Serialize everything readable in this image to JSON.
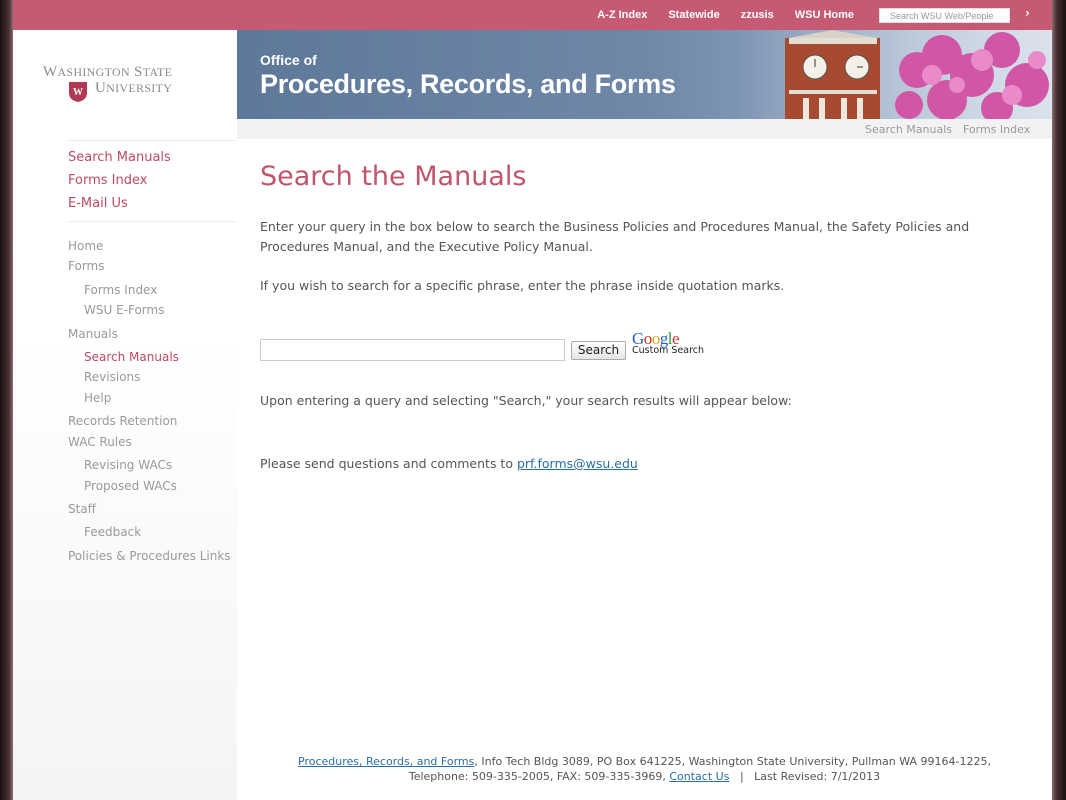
{
  "topbar": {
    "links": [
      "A-Z Index",
      "Statewide",
      "zzusis",
      "WSU Home"
    ],
    "search_placeholder": "Search WSU Web/People",
    "go_icon": "chevron-right-icon"
  },
  "logo": {
    "line1": "Washington State",
    "line2": "University"
  },
  "banner": {
    "line1": "Office of",
    "line2": "Procedures, Records, and Forms"
  },
  "subnav": {
    "search_manuals": "Search Manuals",
    "forms_index": "Forms Index"
  },
  "sidebar": {
    "primary": [
      "Search Manuals",
      "Forms Index",
      "E-Mail Us"
    ],
    "home": "Home",
    "forms": "Forms",
    "forms_index": "Forms Index",
    "wsu_eforms": "WSU E-Forms",
    "manuals": "Manuals",
    "search_manuals": "Search Manuals",
    "revisions": "Revisions",
    "help": "Help",
    "records_retention": "Records Retention",
    "wac_rules": "WAC Rules",
    "revising_wacs": "Revising WACs",
    "proposed_wacs": "Proposed WACs",
    "staff": "Staff",
    "feedback": "Feedback",
    "policies_links": "Policies & Procedures Links"
  },
  "main": {
    "title": "Search the Manuals",
    "intro": "Enter your query in the box below to search the Business Policies and Procedures Manual, the Safety Policies and Procedures Manual, and the Executive Policy Manual.",
    "phrase_tip": "If you wish to search for a specific phrase, enter the phrase inside quotation marks.",
    "search_value": "",
    "search_button": "Search",
    "google_label": "Google",
    "custom_search_label": "Custom Search",
    "results_note": "Upon entering a query and selecting \"Search,\" your search results will appear below:",
    "contact_prefix": "Please send questions and comments to",
    "contact_email": "prf.forms@wsu.edu"
  },
  "footer": {
    "office_link": "Procedures, Records, and Forms",
    "address": ", Info Tech Bldg 3089, PO Box 641225, Washington State University, Pullman WA 99164-1225,",
    "phone_fax": "Telephone: 509-335-2005, FAX: 509-335-3969,",
    "contact_link": "Contact Us",
    "separator": "|",
    "last_revised": "Last Revised: 7/1/2013"
  },
  "colors": {
    "topbar": "#c65a72",
    "accent": "#bd4a63",
    "link": "#2a6ea6",
    "banner": "#6f88a8"
  }
}
